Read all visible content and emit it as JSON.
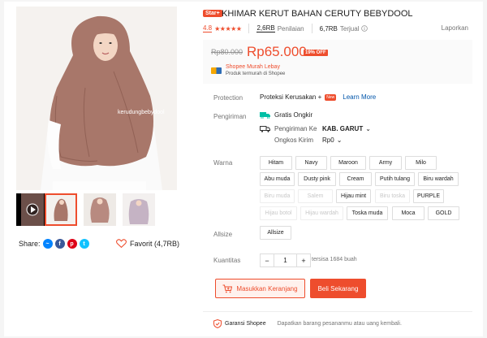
{
  "product": {
    "badge": "Star+",
    "title": "KHIMAR KERUT BAHAN CERUTY BEBYDOOL",
    "rating": "4.8",
    "stars": "★★★★★",
    "ratings_count": "2,6RB",
    "ratings_label": "Penilaian",
    "sold_count": "6,7RB",
    "sold_label": "Terjual",
    "report": "Laporkan"
  },
  "price": {
    "original": "Rp80.000",
    "current": "Rp65.000",
    "discount": "19% OFF",
    "promo_title": "Shopee Murah Lebay",
    "promo_sub": "Produk termurah di Shopee"
  },
  "protection": {
    "label": "Protection",
    "value": "Proteksi Kerusakan +",
    "new_badge": "New",
    "link": "Learn More"
  },
  "shipping": {
    "label": "Pengiriman",
    "free": "Gratis Ongkir",
    "to_label": "Pengiriman Ke",
    "to_value": "KAB. GARUT",
    "cost_label": "Ongkos Kirim",
    "cost_value": "Rp0"
  },
  "variants": {
    "color_label": "Warna",
    "colors": [
      {
        "name": "Hitam",
        "disabled": false
      },
      {
        "name": "Navy",
        "disabled": false
      },
      {
        "name": "Maroon",
        "disabled": false
      },
      {
        "name": "Army",
        "disabled": false
      },
      {
        "name": "Milo",
        "disabled": false
      },
      {
        "name": "Abu muda",
        "disabled": false
      },
      {
        "name": "Dusty pink",
        "disabled": false
      },
      {
        "name": "Cream",
        "disabled": false
      },
      {
        "name": "Putih tulang",
        "disabled": false
      },
      {
        "name": "Biru wardah",
        "disabled": false
      },
      {
        "name": "Biru muda",
        "disabled": true
      },
      {
        "name": "Salem",
        "disabled": true
      },
      {
        "name": "Hijau mint",
        "disabled": false
      },
      {
        "name": "Biru toska",
        "disabled": true
      },
      {
        "name": "PURPLE",
        "disabled": false
      },
      {
        "name": "Hijau botol",
        "disabled": true
      },
      {
        "name": "Hijau wardah",
        "disabled": true
      },
      {
        "name": "Toska muda",
        "disabled": false
      },
      {
        "name": "Moca",
        "disabled": false
      },
      {
        "name": "GOLD",
        "disabled": false
      }
    ],
    "size_label": "Allsize",
    "size_option": "Allsize"
  },
  "quantity": {
    "label": "Kuantitas",
    "minus": "−",
    "value": "1",
    "plus": "+",
    "stock": "tersisa 1684 buah"
  },
  "actions": {
    "add_to_cart": "Masukkan Keranjang",
    "buy_now": "Beli Sekarang"
  },
  "footer": {
    "guarantee": "Garansi Shopee",
    "guarantee_text": "Dapatkan barang pesananmu atau uang kembali."
  },
  "gallery": {
    "share_label": "Share:",
    "favorite_label": "Favorit (4,7RB)",
    "watermark": "kerudungbebydool"
  },
  "colors": {
    "accent": "#ee4d2d",
    "free_shipping": "#00bfa5"
  }
}
